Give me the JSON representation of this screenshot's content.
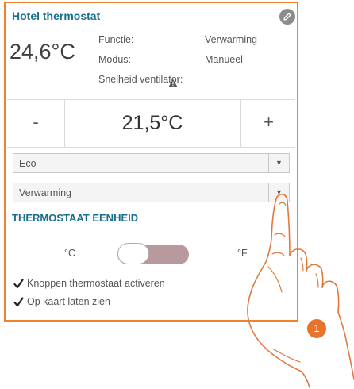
{
  "widget": {
    "title": "Hotel thermostat",
    "current_temperature": "24,6°C",
    "info": {
      "function_label": "Functie:",
      "function_value": "Verwarming",
      "mode_label": "Modus:",
      "mode_value": "Manueel",
      "fan_speed_label": "Snelheid ventilator:"
    },
    "setpoint": {
      "minus_label": "-",
      "value": "21,5°C",
      "plus_label": "+"
    },
    "mode_select": {
      "value": "Eco"
    },
    "function_select": {
      "value": "Verwarming"
    },
    "unit_section": {
      "title": "THERMOSTAAT EENHEID",
      "celsius_label": "°C",
      "fahrenheit_label": "°F",
      "toggle_state": "celsius"
    },
    "options": [
      {
        "label": "Knoppen thermostaat activeren",
        "checked": true
      },
      {
        "label": "Op kaart laten zien",
        "checked": true
      }
    ]
  },
  "callout": {
    "number": "1"
  },
  "colors": {
    "border": "#f0822f",
    "title": "#1b6e8f",
    "badge": "#e8732b",
    "toggle_track": "#b89a9e"
  }
}
